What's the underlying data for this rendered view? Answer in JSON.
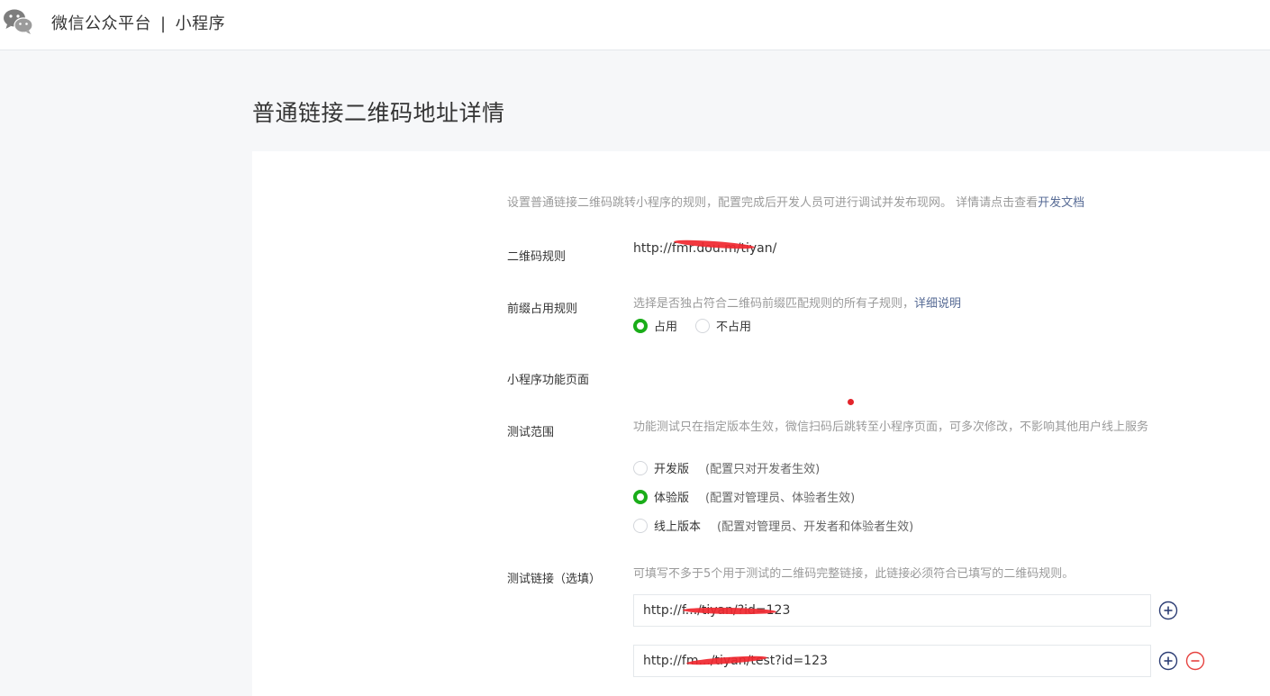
{
  "header": {
    "brand": "微信公众平台",
    "separator": "|",
    "product": "小程序"
  },
  "page": {
    "title": "普通链接二维码地址详情"
  },
  "intro": {
    "text": "设置普通链接二维码跳转小程序的规则，配置完成后开发人员可进行调试并发布现网。 详情请点击查看",
    "link": "开发文档"
  },
  "form": {
    "qr_rule": {
      "label": "二维码规则",
      "value": "http://fmr.dou.m/tiyan/"
    },
    "prefix_rule": {
      "label": "前缀占用规则",
      "hint": "选择是否独占符合二维码前缀匹配规则的所有子规则，",
      "hint_link": "详细说明",
      "options": [
        {
          "label": "占用",
          "checked": true
        },
        {
          "label": "不占用",
          "checked": false
        }
      ]
    },
    "mini_page": {
      "label": "小程序功能页面"
    },
    "test_scope": {
      "label": "测试范围",
      "hint": "功能测试只在指定版本生效，微信扫码后跳转至小程序页面，可多次修改，不影响其他用户线上服务",
      "options": [
        {
          "label": "开发版",
          "note": "(配置只对开发者生效)",
          "checked": false
        },
        {
          "label": "体验版",
          "note": "(配置对管理员、体验者生效)",
          "checked": true
        },
        {
          "label": "线上版本",
          "note": "(配置对管理员、开发者和体验者生效)",
          "checked": false
        }
      ]
    },
    "test_links": {
      "label": "测试链接（选填）",
      "hint": "可填写不多于5个用于测试的二维码完整链接，此链接必须符合已填写的二维码规则。",
      "links": [
        {
          "value": "http://f.../tiyan/?id=123"
        },
        {
          "value": "http://fm.../tiyan/test?id=123"
        }
      ]
    }
  },
  "colors": {
    "accent_green": "#1aad19",
    "link_blue": "#576b95",
    "add_icon": "#2d3e75",
    "remove_icon": "#e64340",
    "redaction": "#f0272f"
  }
}
